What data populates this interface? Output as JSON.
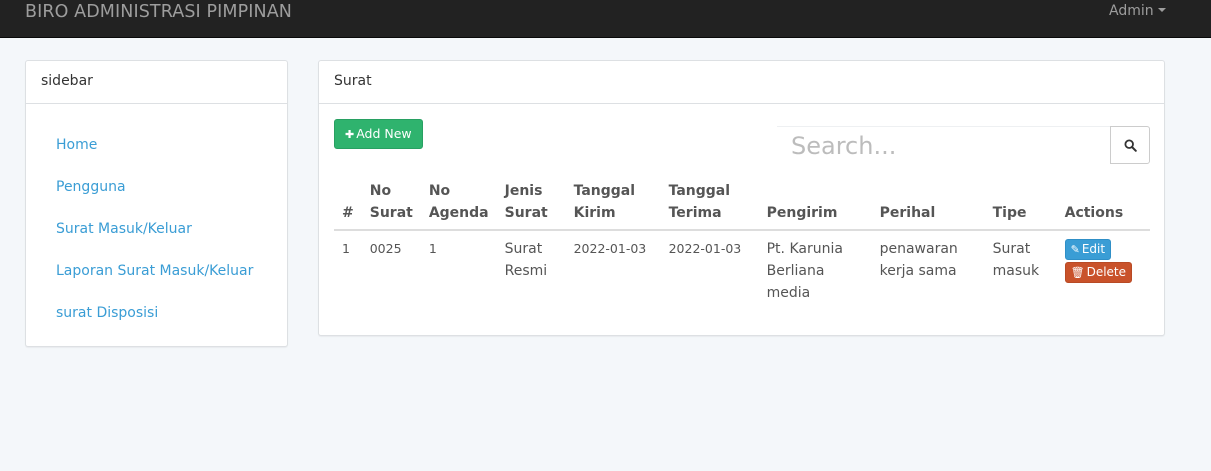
{
  "navbar": {
    "brand": "BIRO ADMINISTRASI PIMPINAN",
    "user_label": "Admin"
  },
  "sidebar": {
    "title": "sidebar",
    "items": [
      {
        "label": "Home"
      },
      {
        "label": "Pengguna"
      },
      {
        "label": "Surat Masuk/Keluar"
      },
      {
        "label": "Laporan Surat Masuk/Keluar"
      },
      {
        "label": "surat Disposisi"
      }
    ]
  },
  "main": {
    "title": "Surat",
    "add_button": "Add New",
    "search_placeholder": "Search...",
    "table": {
      "headers": [
        "#",
        "No Surat",
        "No Agenda",
        "Jenis Surat",
        "Tanggal Kirim",
        "Tanggal Terima",
        "Pengirim",
        "Perihal",
        "Tipe",
        "Actions"
      ],
      "rows": [
        {
          "num": "1",
          "no_surat": "0025",
          "no_agenda": "1",
          "jenis_surat": "Surat Resmi",
          "tanggal_kirim": "2022-01-03",
          "tanggal_terima": "2022-01-03",
          "pengirim": "Pt. Karunia Berliana media",
          "perihal": "penawaran kerja sama",
          "tipe": "Surat masuk",
          "edit_label": "Edit",
          "delete_label": "Delete"
        }
      ]
    }
  },
  "icons": {
    "plus": "plus-icon",
    "search": "search-icon",
    "edit": "edit-icon",
    "delete": "trash-icon",
    "caret": "caret-down-icon"
  },
  "colors": {
    "navbar_bg": "#222222",
    "link": "#3a9dd5",
    "add_button": "#2fb36e",
    "edit_button": "#3a9dd5",
    "delete_button": "#c9522a"
  }
}
